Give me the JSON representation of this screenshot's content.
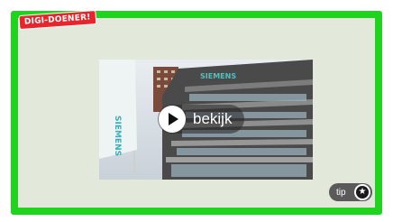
{
  "brand": {
    "badge_label": "DIGI-DOENER!"
  },
  "video": {
    "watch_label": "bekijk",
    "building_sign": "SIEMENS",
    "flag_text": "SIEMENS"
  },
  "tip": {
    "label": "tip",
    "icon": "star-icon"
  },
  "colors": {
    "frame": "#1fd31f",
    "panel": "#e3e9da",
    "badge": "#e8252c"
  }
}
